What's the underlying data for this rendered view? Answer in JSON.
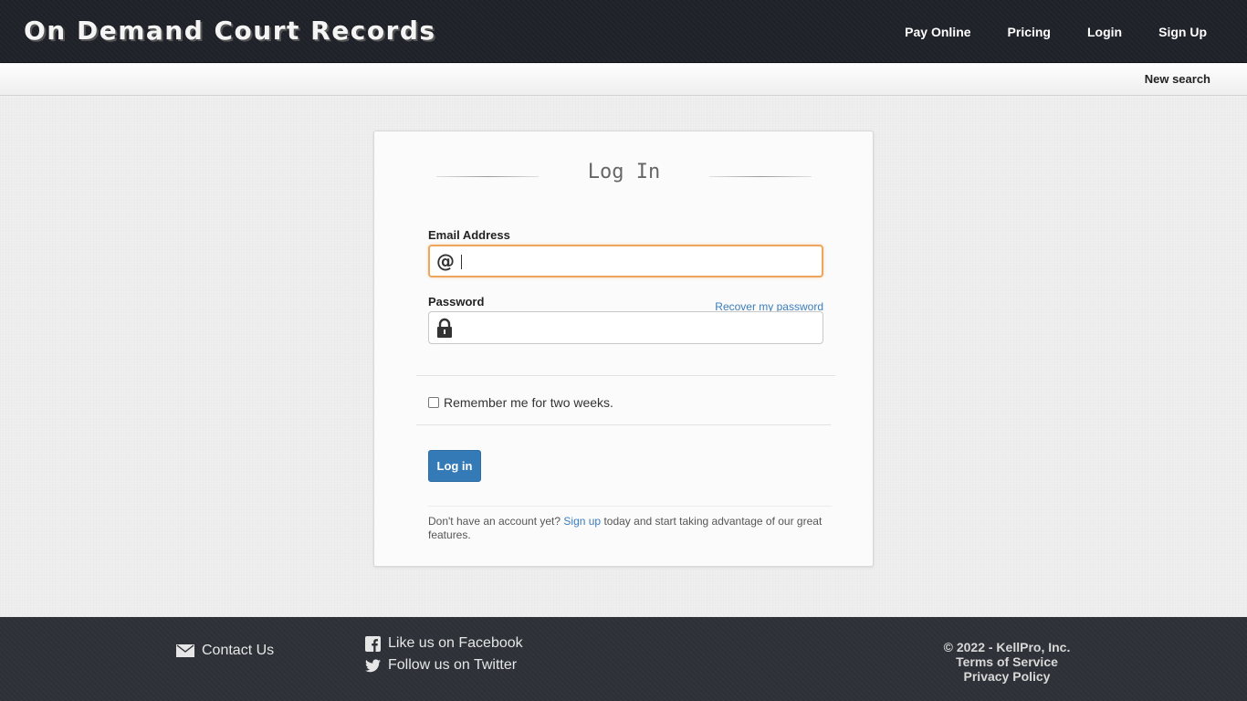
{
  "header": {
    "brand": "On Demand Court Records",
    "nav": [
      {
        "label": "Pay Online"
      },
      {
        "label": "Pricing"
      },
      {
        "label": "Login"
      },
      {
        "label": "Sign Up"
      }
    ]
  },
  "subbar": {
    "new_search": "New search"
  },
  "login_card": {
    "title": "Log In",
    "email_label": "Email Address",
    "email_icon": "at-icon",
    "email_value": "",
    "password_label": "Password",
    "password_icon": "lock-icon",
    "password_value": "",
    "recover_link": "Recover my password",
    "remember_label": "Remember me for two weeks.",
    "remember_checked": false,
    "submit_label": "Log in",
    "signup_prefix": "Don't have an account yet?",
    "signup_link": "Sign up",
    "signup_suffix": "today and start taking advantage of our great features."
  },
  "footer": {
    "contact": "Contact Us",
    "facebook": "Like us on Facebook",
    "twitter": "Follow us on Twitter",
    "copyright": "© 2022 - KellPro, Inc.",
    "terms": "Terms of Service",
    "privacy": "Privacy Policy"
  },
  "colors": {
    "navbar_bg": "#1e2128",
    "accent_link": "#3b7dbd",
    "button_primary": "#337ab7",
    "focus_border": "#eda65c",
    "footer_bg": "#2d3036"
  }
}
